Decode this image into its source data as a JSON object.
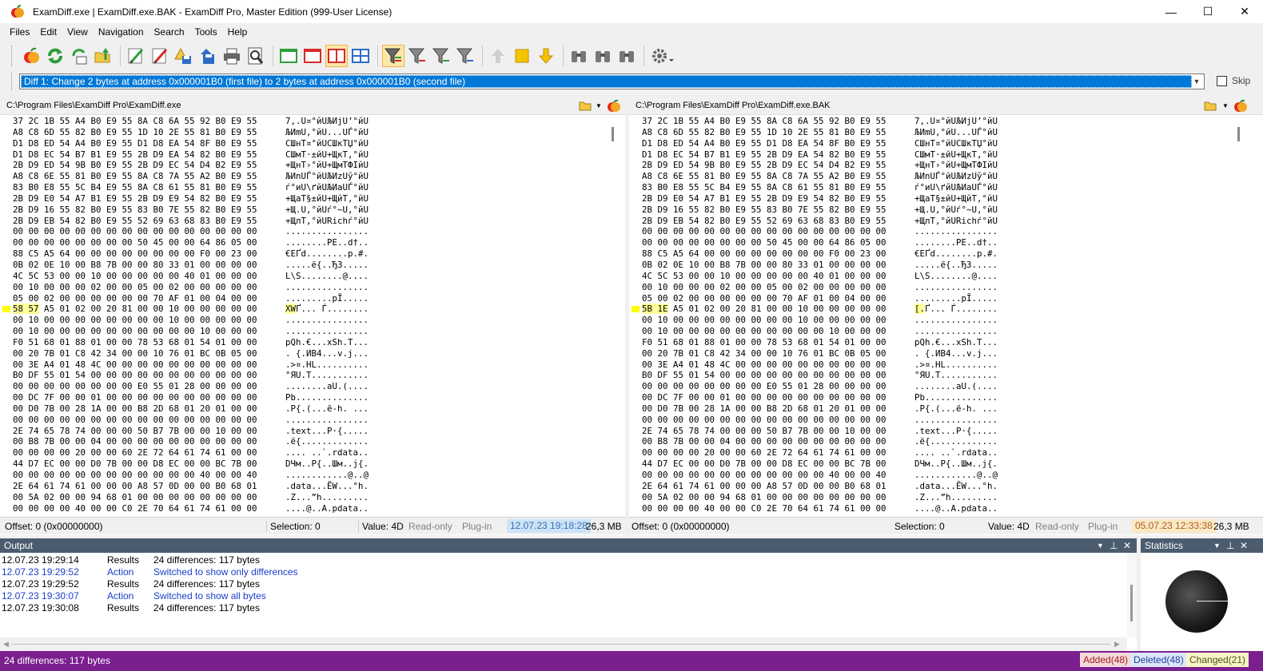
{
  "window": {
    "title": "ExamDiff.exe  |  ExamDiff.exe.BAK - ExamDiff Pro, Master Edition (999-User License)",
    "minimize": "—",
    "maximize": "☐",
    "close": "✕"
  },
  "menu": [
    "Files",
    "Edit",
    "View",
    "Navigation",
    "Search",
    "Tools",
    "Help"
  ],
  "diff_selector": {
    "value": "Diff 1: Change 2 bytes at address 0x000001B0 (first file) to 2 bytes at address 0x000001B0 (second file)",
    "skip_label": "Skip"
  },
  "left": {
    "path": "C:\\Program Files\\ExamDiff Pro\\ExamDiff.exe",
    "status": {
      "offset": "Offset: 0 (0x00000000)",
      "selection": "Selection: 0",
      "value": "Value: 4D",
      "readonly": "Read-only",
      "plugin": "Plug-in",
      "date": "12.07.23 19:18:28",
      "size": "26,3 MB"
    }
  },
  "right": {
    "path": "C:\\Program Files\\ExamDiff Pro\\ExamDiff.exe.BAK",
    "status": {
      "offset": "Offset: 0 (0x00000000)",
      "selection": "Selection: 0",
      "value": "Value: 4D",
      "readonly": "Read-only",
      "plugin": "Plug-in",
      "date": "05.07.23 12:33:38",
      "size": "26,3 MB"
    }
  },
  "hex_rows": [
    {
      "hex": "37 2C 1B 55 A4 B0 E9 55 8A C8 6A 55 92 B0 E9 55",
      "ascii": "7,.U¤°йUЉИjU’°йU"
    },
    {
      "hex": "A8 C8 6D 55 82 B0 E9 55 1D 10 2E 55 81 B0 E9 55",
      "ascii": "ЉИmU‚°йU...UЃ°йU"
    },
    {
      "hex": "D1 D8 ED 54 A4 B0 E9 55 D1 D8 EA 54 8F B0 E9 55",
      "ascii": "СШнТ¤°йUСШкТЏ°йU"
    },
    {
      "hex": "D1 D8 EC 54 B7 B1 E9 55 2B D9 EA 54 82 B0 E9 55",
      "ascii": "СШмТ·±йU+ЩкТ‚°йU"
    },
    {
      "hex": "2B D9 ED 54 9B B0 E9 55 2B D9 EC 54 D4 B2 E9 55",
      "ascii": "+ЩнТ›°йU+ЩмТФІйU"
    },
    {
      "hex": "A8 C8 6E 55 81 B0 E9 55 8A C8 7A 55 A2 B0 E9 55",
      "ascii": "ЉИnUЃ°йUЉИzUў°йU"
    },
    {
      "hex": "83 B0 E8 55 5C B4 E9 55 8A C8 61 55 81 B0 E9 55",
      "ascii": "ѓ°иU\\ґйUЉИaUЃ°йU"
    },
    {
      "hex": "2B D9 E0 54 A7 B1 E9 55 2B D9 E9 54 82 B0 E9 55",
      "ascii": "+ЩаТ§±йU+ЩйТ‚°йU"
    },
    {
      "hex": "2B D9 16 55 82 B0 E9 55 83 B0 7E 55 82 B0 E9 55",
      "ascii": "+Щ.U‚°йUѓ°~U‚°йU"
    },
    {
      "hex": "2B D9 EB 54 82 B0 E9 55 52 69 63 68 83 B0 E9 55",
      "ascii": "+ЩлТ‚°йURichѓ°йU"
    },
    {
      "hex": "00 00 00 00 00 00 00 00 00 00 00 00 00 00 00 00",
      "ascii": "................"
    },
    {
      "hex": "00 00 00 00 00 00 00 00 50 45 00 00 64 86 05 00",
      "ascii": "........PE..d†.."
    },
    {
      "hex": "88 C5 A5 64 00 00 00 00 00 00 00 00 F0 00 23 00",
      "ascii": "€ЕҐd........р.#."
    },
    {
      "hex": "0B 02 0E 10 00 B8 7B 00 00 80 33 01 00 00 00 00",
      "ascii": ".....ё{..Ђ3....."
    },
    {
      "hex": "4C 5C 53 00 00 10 00 00 00 00 00 40 01 00 00 00",
      "ascii": "L\\S........@...."
    },
    {
      "hex": "00 10 00 00 00 02 00 00 05 00 02 00 00 00 00 00",
      "ascii": "................"
    },
    {
      "hex": "05 00 02 00 00 00 00 00 00 70 AF 01 00 04 00 00",
      "ascii": ".........pЇ....."
    },
    {
      "hex": "58 57 A5 01 02 00 20 81 00 00 10 00 00 00 00 00",
      "ascii": "XWҐ... Ѓ........",
      "diff": true,
      "dh": "58 57",
      "rh": "5B 1E",
      "da": "XW",
      "ra": "[."
    },
    {
      "hex": "00 10 00 00 00 00 00 00 00 00 10 00 00 00 00 00",
      "ascii": "................"
    },
    {
      "hex": "00 10 00 00 00 00 00 00 00 00 00 00 10 00 00 00",
      "ascii": "................"
    },
    {
      "hex": "F0 51 68 01 88 01 00 00 78 53 68 01 54 01 00 00",
      "ascii": "рQh.€...xSh.T..."
    },
    {
      "hex": "00 20 7B 01 C8 42 34 00 00 10 76 01 BC 0B 05 00",
      "ascii": ". {.ИB4...v.ј..."
    },
    {
      "hex": "00 3E A4 01 48 4C 00 00 00 00 00 00 00 00 00 00",
      "ascii": ".>¤.HL.........."
    },
    {
      "hex": "B0 DF 55 01 54 00 00 00 00 00 00 00 00 00 00 00",
      "ascii": "°ЯU.T..........."
    },
    {
      "hex": "00 00 00 00 00 00 00 00 E0 55 01 28 00 00 00 00",
      "ascii": "........аU.(...."
    },
    {
      "hex": "00 DC 7F 00 00 01 00 00 00 00 00 00 00 00 00 00",
      "ascii": "Pb.............."
    },
    {
      "hex": "00 D0 7B 00 28 1A 00 00 B8 2D 68 01 20 01 00 00",
      "ascii": ".Р{.(...ё-h. ..."
    },
    {
      "hex": "00 00 00 00 00 00 00 00 00 00 00 00 00 00 00 00",
      "ascii": "................"
    },
    {
      "hex": "2E 74 65 78 74 00 00 00 50 B7 7B 00 00 10 00 00",
      "ascii": ".text...P·{....."
    },
    {
      "hex": "00 B8 7B 00 00 04 00 00 00 00 00 00 00 00 00 00",
      "ascii": ".ё{............."
    },
    {
      "hex": "00 00 00 00 20 00 00 60 2E 72 64 61 74 61 00 00",
      "ascii": ".... ..`.rdata.."
    },
    {
      "hex": "44 D7 EC 00 00 D0 7B 00 00 D8 EC 00 00 BC 7B 00",
      "ascii": "DЧм..Р{..Шм..ј{."
    },
    {
      "hex": "00 00 00 00 00 00 00 00 00 00 00 00 40 00 00 40",
      "ascii": "............@..@"
    },
    {
      "hex": "2E 64 61 74 61 00 00 00 A8 57 0D 00 00 B0 68 01",
      "ascii": ".data...ЁW...°h."
    },
    {
      "hex": "00 5A 02 00 00 94 68 01 00 00 00 00 00 00 00 00",
      "ascii": ".Z...”h........."
    },
    {
      "hex": "00 00 00 00 40 00 00 C0 2E 70 64 61 74 61 00 00",
      "ascii": "....@..А.pdata.."
    }
  ],
  "output": {
    "title": "Output",
    "rows": [
      {
        "time": "12.07.23 19:29:14",
        "type": "Results",
        "msg": "24 differences: 117 bytes",
        "blue": false
      },
      {
        "time": "12.07.23 19:29:52",
        "type": "Action",
        "msg": "Switched to show only differences",
        "blue": true
      },
      {
        "time": "12.07.23 19:29:52",
        "type": "Results",
        "msg": "24 differences: 117 bytes",
        "blue": false
      },
      {
        "time": "12.07.23 19:30:07",
        "type": "Action",
        "msg": "Switched to show all bytes",
        "blue": true
      },
      {
        "time": "12.07.23 19:30:08",
        "type": "Results",
        "msg": "24 differences: 117 bytes",
        "blue": false
      }
    ]
  },
  "statistics": {
    "title": "Statistics"
  },
  "bottom": {
    "summary": "24 differences: 117 bytes",
    "added": "Added(48)",
    "deleted": "Deleted(48)",
    "changed": "Changed(21)"
  },
  "colors": {
    "accent": "#0078d7",
    "panel_header": "#4a5c6e",
    "status_bar": "#7b1f8f",
    "diff_marker": "#ffff00"
  }
}
